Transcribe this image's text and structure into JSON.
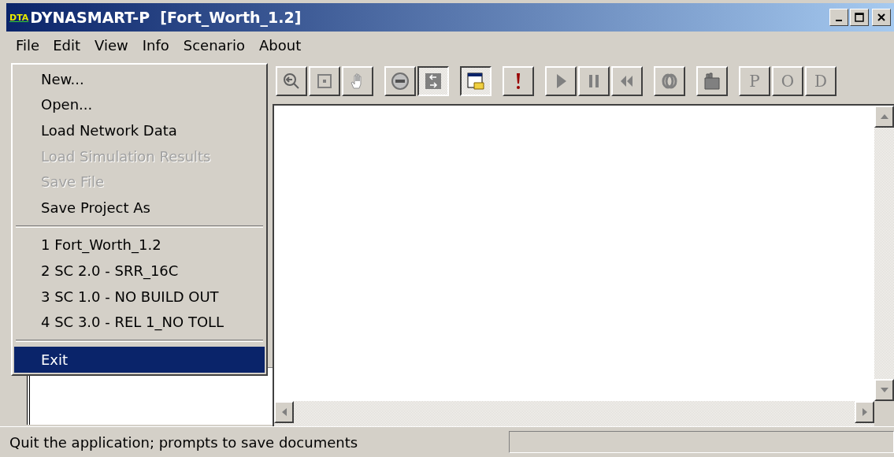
{
  "window": {
    "logo_text": "DTA",
    "title": "DYNASMART-P  [Fort_Worth_1.2]"
  },
  "menubar": [
    {
      "label": "File",
      "selected": true
    },
    {
      "label": "Edit",
      "selected": false
    },
    {
      "label": "View",
      "selected": false
    },
    {
      "label": "Info",
      "selected": false
    },
    {
      "label": "Scenario",
      "selected": false
    },
    {
      "label": "About",
      "selected": false
    }
  ],
  "file_menu": [
    {
      "kind": "item",
      "label": "New...",
      "disabled": false,
      "selected": false
    },
    {
      "kind": "item",
      "label": "Open...",
      "disabled": false,
      "selected": false
    },
    {
      "kind": "item",
      "label": "Load Network Data",
      "disabled": false,
      "selected": false
    },
    {
      "kind": "item",
      "label": "Load Simulation Results",
      "disabled": true,
      "selected": false
    },
    {
      "kind": "item",
      "label": "Save File",
      "disabled": true,
      "selected": false
    },
    {
      "kind": "item",
      "label": "Save Project As",
      "disabled": false,
      "selected": false
    },
    {
      "kind": "separator"
    },
    {
      "kind": "item",
      "label": "1 Fort_Worth_1.2",
      "disabled": false,
      "selected": false
    },
    {
      "kind": "item",
      "label": "2 SC 2.0 - SRR_16C",
      "disabled": false,
      "selected": false
    },
    {
      "kind": "item",
      "label": "3 SC 1.0 - NO BUILD OUT",
      "disabled": false,
      "selected": false
    },
    {
      "kind": "item",
      "label": "4 SC 3.0 - REL 1_NO TOLL",
      "disabled": false,
      "selected": false
    },
    {
      "kind": "separator"
    },
    {
      "kind": "item",
      "label": "Exit",
      "disabled": false,
      "selected": true
    }
  ],
  "toolbar_groups": [
    [
      {
        "kind": "zoom",
        "pressed": false
      },
      {
        "kind": "frame",
        "pressed": false
      },
      {
        "kind": "hand",
        "pressed": false
      }
    ],
    [
      {
        "kind": "no-entry",
        "pressed": false
      },
      {
        "kind": "arrows",
        "pressed": true
      }
    ],
    [
      {
        "kind": "window",
        "pressed": true
      }
    ],
    [
      {
        "kind": "alert",
        "pressed": false
      }
    ],
    [
      {
        "kind": "play",
        "pressed": false
      },
      {
        "kind": "pause",
        "pressed": false
      },
      {
        "kind": "rewind",
        "pressed": false
      }
    ],
    [
      {
        "kind": "rings",
        "pressed": false
      }
    ],
    [
      {
        "kind": "bag",
        "pressed": false
      }
    ],
    [
      {
        "kind": "text",
        "label": "P",
        "pressed": false
      },
      {
        "kind": "text",
        "label": "O",
        "pressed": false
      },
      {
        "kind": "text",
        "label": "D",
        "pressed": false
      }
    ]
  ],
  "status_bar": {
    "message": "Quit the application; prompts to save documents"
  }
}
